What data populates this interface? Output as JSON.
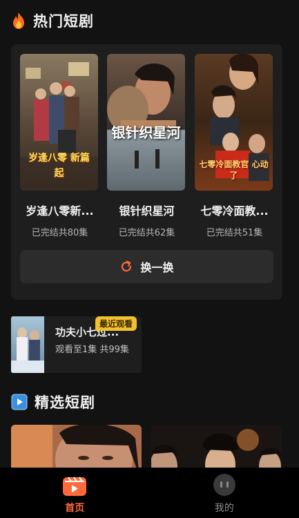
{
  "hot_section": {
    "icon": "fire-icon",
    "title": "热门短剧",
    "dramas": [
      {
        "title": "岁逢八零新...",
        "status": "已完结共80集",
        "poster_text": "岁逢八零 新篇起"
      },
      {
        "title": "银针织星河",
        "status": "已完结共62集",
        "poster_text": "银针织星河"
      },
      {
        "title": "七零冷面教...",
        "status": "已完结共51集",
        "poster_text": "七零冷面教官 心动了"
      }
    ],
    "refresh": {
      "icon": "refresh-icon",
      "label": "换一换"
    }
  },
  "recent_watch": {
    "badge": "最近观看",
    "title": "功夫小七过...",
    "progress": "观看至1集 共99集"
  },
  "selected_section": {
    "icon": "play-icon",
    "title": "精选短剧"
  },
  "bottom_nav": {
    "items": [
      {
        "label": "首页",
        "icon": "home-clapper-icon",
        "active": true
      },
      {
        "label": "我的",
        "icon": "profile-icon",
        "active": false
      }
    ]
  },
  "colors": {
    "accent": "#ff6a3d",
    "badge": "#f2c12e",
    "background": "#121212",
    "panel": "#1e1e1e"
  }
}
